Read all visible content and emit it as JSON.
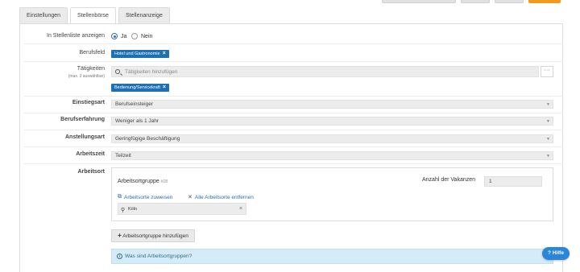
{
  "tabs": [
    {
      "label": "Einstellungen",
      "active": false
    },
    {
      "label": "Stellenbörse",
      "active": true
    },
    {
      "label": "Stellenanzeige",
      "active": false
    }
  ],
  "colors": {
    "accent": "#1f6fb5",
    "top_orange": "#f39a1d",
    "info_bg": "#d5ebf7",
    "help_bg": "#2a86d9"
  },
  "form": {
    "show_in_list": {
      "label": "In Stellenliste anzeigen",
      "options": [
        "Ja",
        "Nein"
      ],
      "selected": "Ja"
    },
    "berufsfeld": {
      "label": "Berufsfeld",
      "chip": "Hotel und Gastronomie"
    },
    "taetigkeiten": {
      "label": "Tätigkeiten",
      "sublabel": "(max. 3 auswählbar)",
      "placeholder": "Tätigkeiten hinzufügen",
      "more": "···",
      "chip": "Bedienung/Servicekraft"
    },
    "einstiegsart": {
      "label": "Einstiegsart",
      "value": "Berufseinsteiger"
    },
    "berufserfahrung": {
      "label": "Berufserfahrung",
      "value": "Weniger als 1 Jahr"
    },
    "anstellungsart": {
      "label": "Anstellungsart",
      "value": "Geringfügige Beschäftigung"
    },
    "arbeitszeit": {
      "label": "Arbeitszeit",
      "value": "Teilzeit"
    },
    "arbeitsort": {
      "label": "Arbeitsort",
      "group_title": "Arbeitsortgruppe",
      "group_number": "#18",
      "vacancies_label": "Anzahl der Vakanzen",
      "vacancies_value": "1",
      "assign_link": "Arbeitsorte zuweisen",
      "remove_all_link": "Alle Arbeitsorte entfernen",
      "location": "Köln"
    },
    "add_group_button": "Arbeitsortgruppe hinzufügen",
    "info_text": "Was sind Arbeitsortgruppen?",
    "help_button": "Hilfe"
  }
}
